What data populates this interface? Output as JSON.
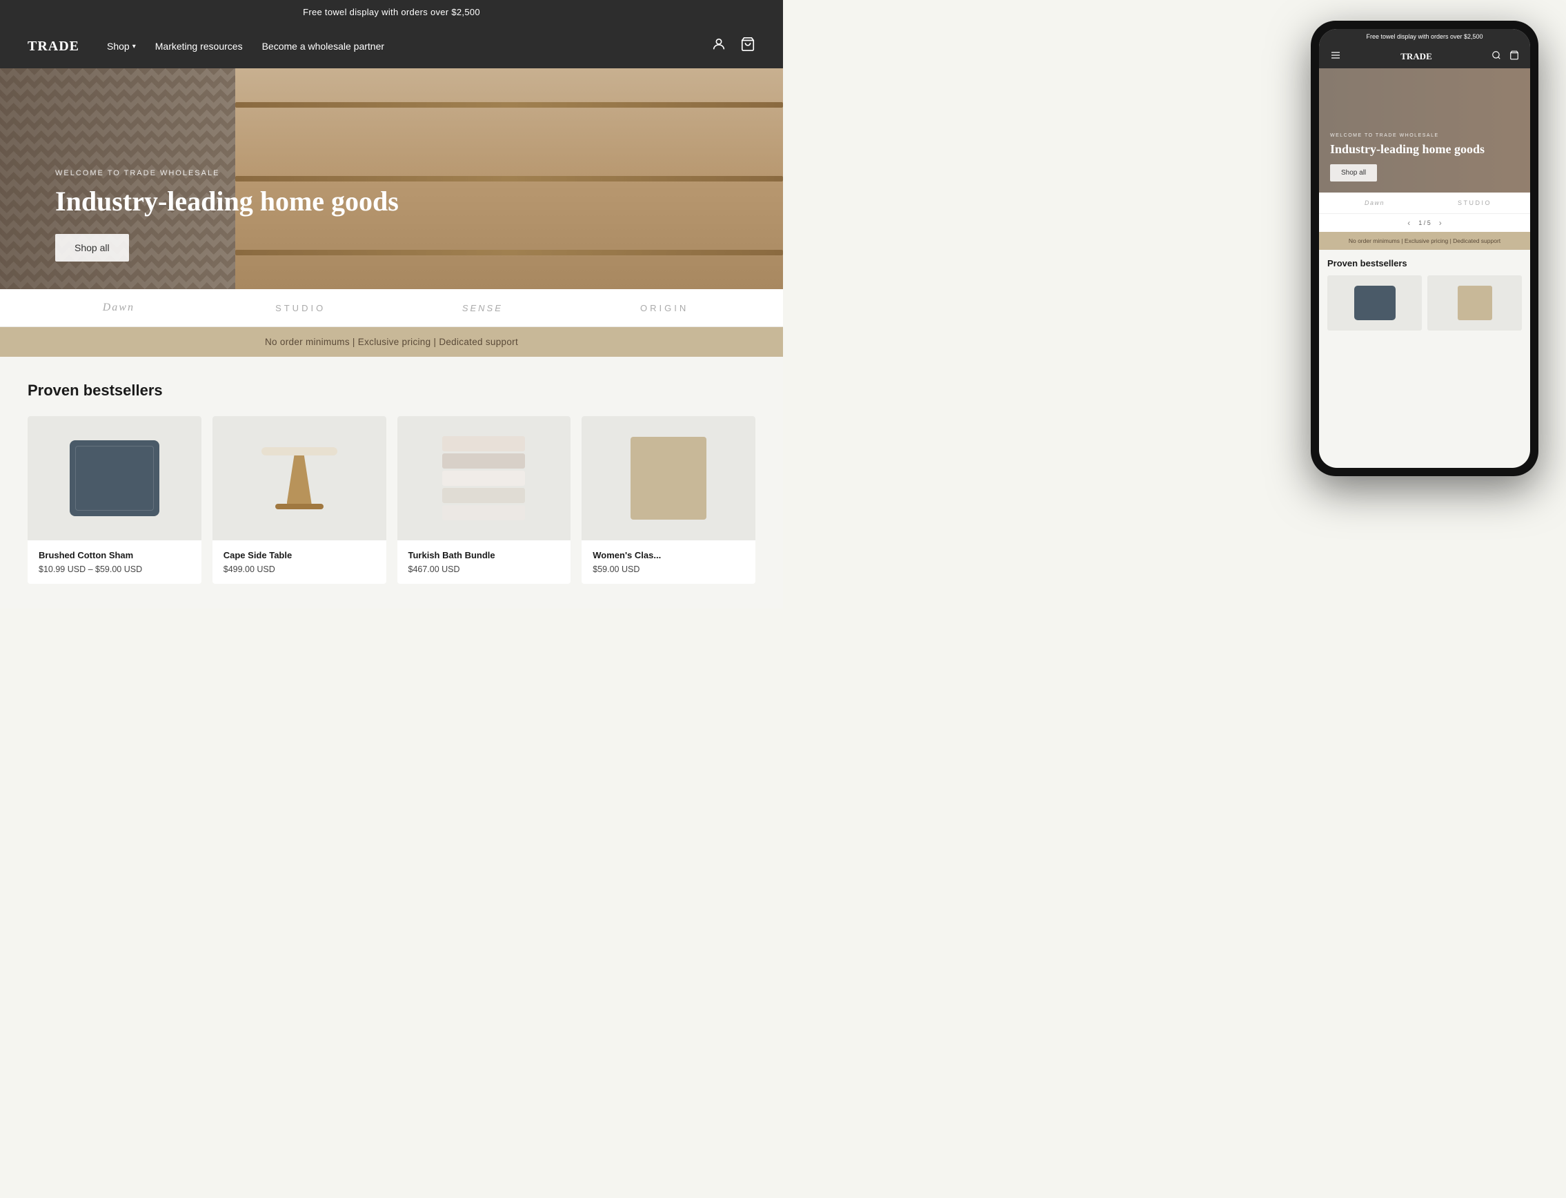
{
  "announcement": {
    "text": "Free towel display with orders over $2,500"
  },
  "header": {
    "logo": "TRADE",
    "nav": [
      {
        "label": "Shop",
        "has_dropdown": true
      },
      {
        "label": "Marketing resources",
        "has_dropdown": false
      },
      {
        "label": "Become a wholesale partner",
        "has_dropdown": false
      }
    ],
    "icons": {
      "login": "👤",
      "cart": "🛒"
    }
  },
  "hero": {
    "subtitle": "WELCOME TO TRADE WHOLESALE",
    "title": "Industry-leading home goods",
    "cta": "Shop all"
  },
  "brands": [
    {
      "name": "Dawn",
      "style": "serif"
    },
    {
      "name": "STUDIO",
      "style": "sans"
    },
    {
      "name": "SENSE",
      "style": "thin"
    },
    {
      "name": "ORIGIN",
      "style": "sans"
    }
  ],
  "features_bar": "No order minimums  |  Exclusive pricing |  Dedicated support",
  "bestsellers": {
    "title": "Proven bestsellers",
    "products": [
      {
        "name": "Brushed Cotton Sham",
        "price_range": "$10.99 USD – $59.00 USD",
        "image_type": "pillow"
      },
      {
        "name": "Cape Side Table",
        "price": "$499.00 USD",
        "image_type": "table"
      },
      {
        "name": "Turkish Bath Bundle",
        "price": "$467.00 USD",
        "image_type": "towels"
      },
      {
        "name": "Women's Clas...",
        "price": "$59.00 USD",
        "image_type": "sweater"
      }
    ]
  },
  "mobile": {
    "announcement": "Free towel display with orders over $2,500",
    "logo": "TRADE",
    "hero": {
      "subtitle": "WELCOME TO TRADE WHOLESALE",
      "title": "Industry-leading home goods",
      "cta": "Shop all"
    },
    "brands": [
      {
        "name": "Dawn",
        "style": "serif"
      },
      {
        "name": "STUDIO",
        "style": "sans"
      }
    ],
    "slider": {
      "current": "1",
      "total": "5"
    },
    "features": "No order minimums  |  Exclusive pricing |  Dedicated support",
    "bestsellers_title": "Proven bestsellers",
    "shop_all": "Shop all"
  },
  "towel_colors": [
    "#e8e0d8",
    "#d8d0c8",
    "#f0ece8",
    "#e0dcd4",
    "#ece8e4"
  ],
  "colors": {
    "dark_bg": "#2d2d2d",
    "hero_bg": "#b5a89a",
    "features_bg": "#c8b898",
    "brand_text": "#aaaaaa"
  }
}
